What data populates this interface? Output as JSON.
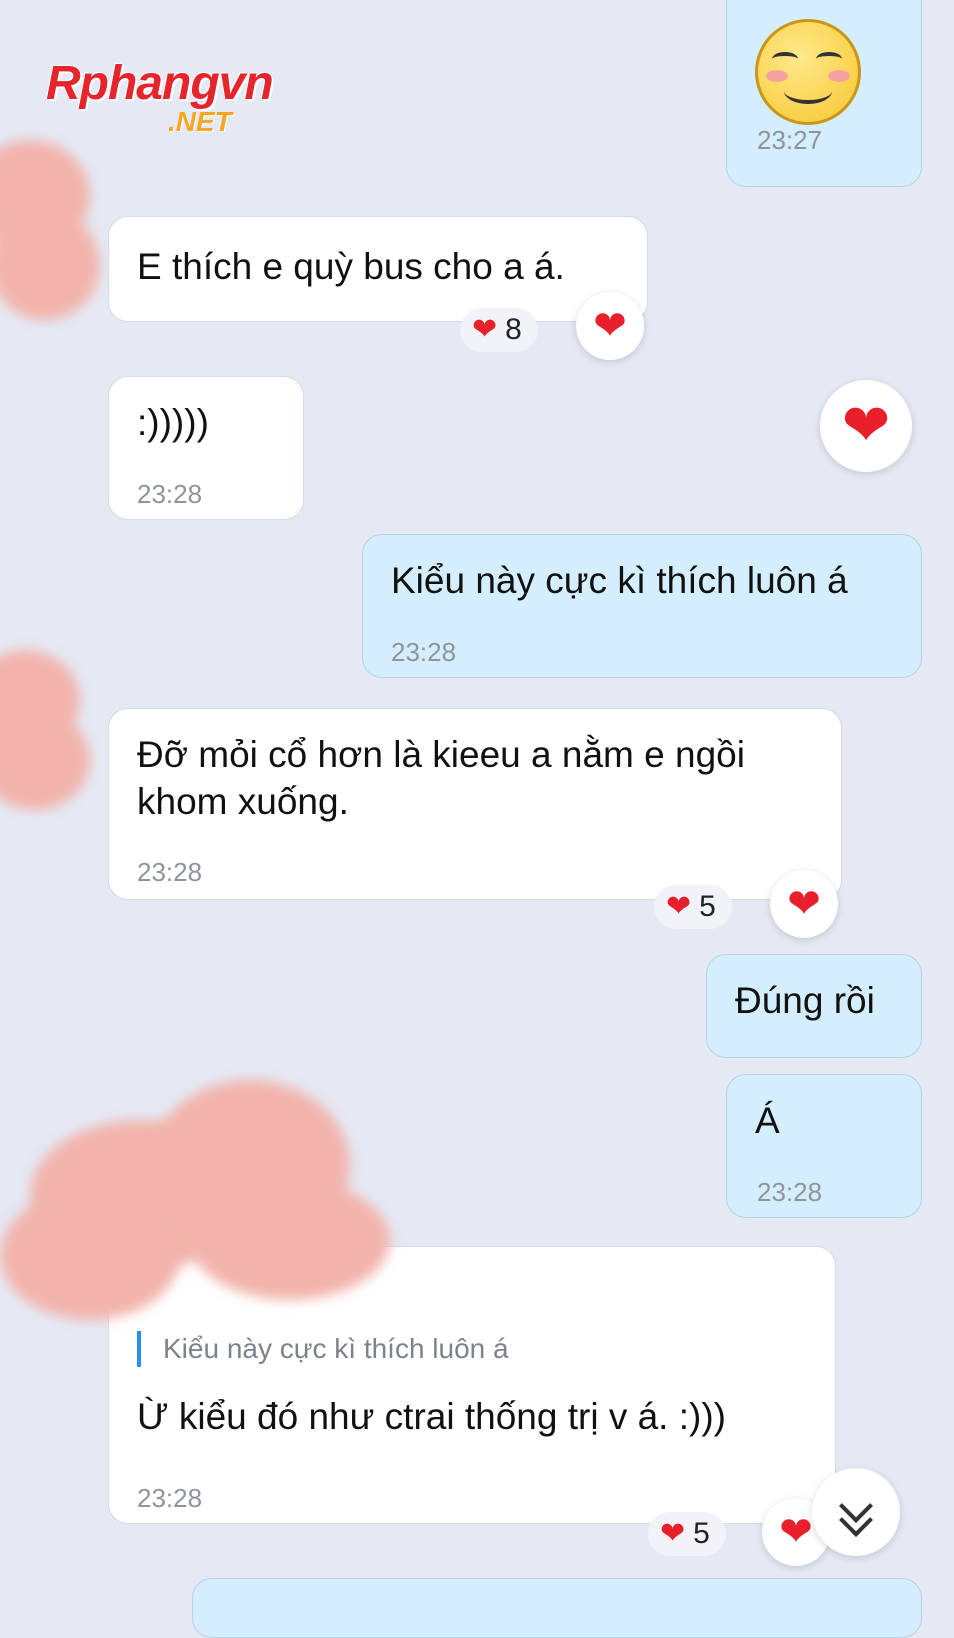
{
  "watermark": {
    "brand": "Rphangvn",
    "tld": ".NET"
  },
  "messages": [
    {
      "id": "m1",
      "side": "out",
      "sticker": "grin-face-sticker",
      "time": "23:27"
    },
    {
      "id": "m2",
      "side": "in",
      "text": "E thích e quỳ bus cho a á.",
      "reaction_count": "8"
    },
    {
      "id": "m3",
      "side": "in",
      "text": ":)))))",
      "time": "23:28"
    },
    {
      "id": "m4",
      "side": "out",
      "text": "Kiểu này cực kì thích luôn á",
      "time": "23:28"
    },
    {
      "id": "m5",
      "side": "in",
      "text_line1": "Đỡ mỏi cổ hơn là kieeu a nằm e ngồi",
      "text_line2": "khom xuống.",
      "time": "23:28",
      "reaction_count": "5"
    },
    {
      "id": "m6",
      "side": "out",
      "text": "Đúng rồi"
    },
    {
      "id": "m7",
      "side": "out",
      "text": "Á",
      "time": "23:28"
    },
    {
      "id": "m8",
      "side": "in",
      "quote": "Kiểu này cực kì thích luôn á",
      "text": "Ừ kiểu đó như ctrai thống trị v á. :)))",
      "time": "23:28",
      "reaction_count": "5"
    }
  ],
  "icons": {
    "heart": "❤",
    "chevrons": "⌄"
  },
  "colors": {
    "incoming": "#ffffff",
    "outgoing": "#d4eefd",
    "background": "#e5e9f4",
    "heart": "#e8202c"
  }
}
